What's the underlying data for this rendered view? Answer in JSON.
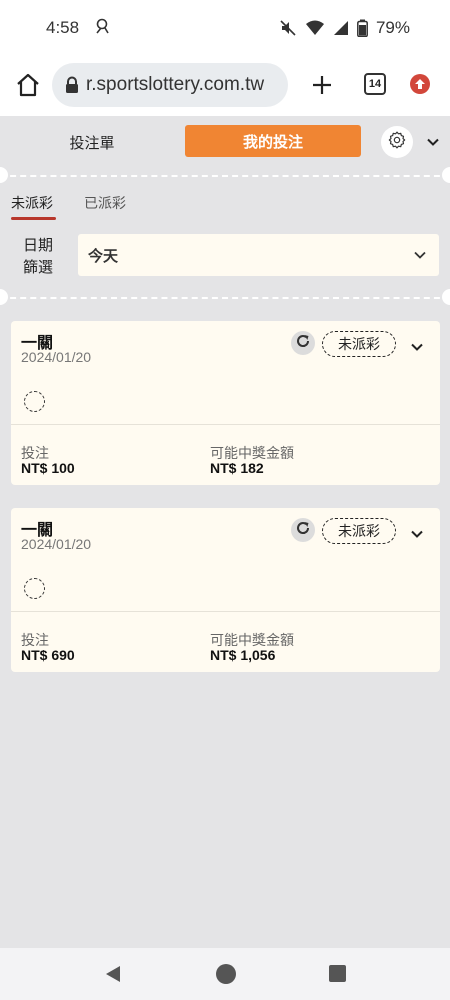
{
  "status_bar": {
    "time": "4:58",
    "battery": "79%"
  },
  "browser": {
    "url": "r.sportslottery.com.tw",
    "tab_count": "14"
  },
  "header": {
    "betslip_tab": "投注單",
    "my_bets_tab": "我的投注",
    "accent_color": "#f08533"
  },
  "filters": {
    "tabs": [
      "未派彩",
      "已派彩"
    ],
    "active_tab": 0,
    "date_label_line1": "日期",
    "date_label_line2": "篩選",
    "date_value": "今天"
  },
  "bets": [
    {
      "type": "一關",
      "date": "2024/01/20",
      "status": "未派彩",
      "stake_label": "投注",
      "stake": "NT$ 100",
      "payout_label": "可能中獎金額",
      "payout": "NT$ 182"
    },
    {
      "type": "一關",
      "date": "2024/01/20",
      "status": "未派彩",
      "stake_label": "投注",
      "stake": "NT$ 690",
      "payout_label": "可能中獎金額",
      "payout": "NT$ 1,056"
    }
  ]
}
